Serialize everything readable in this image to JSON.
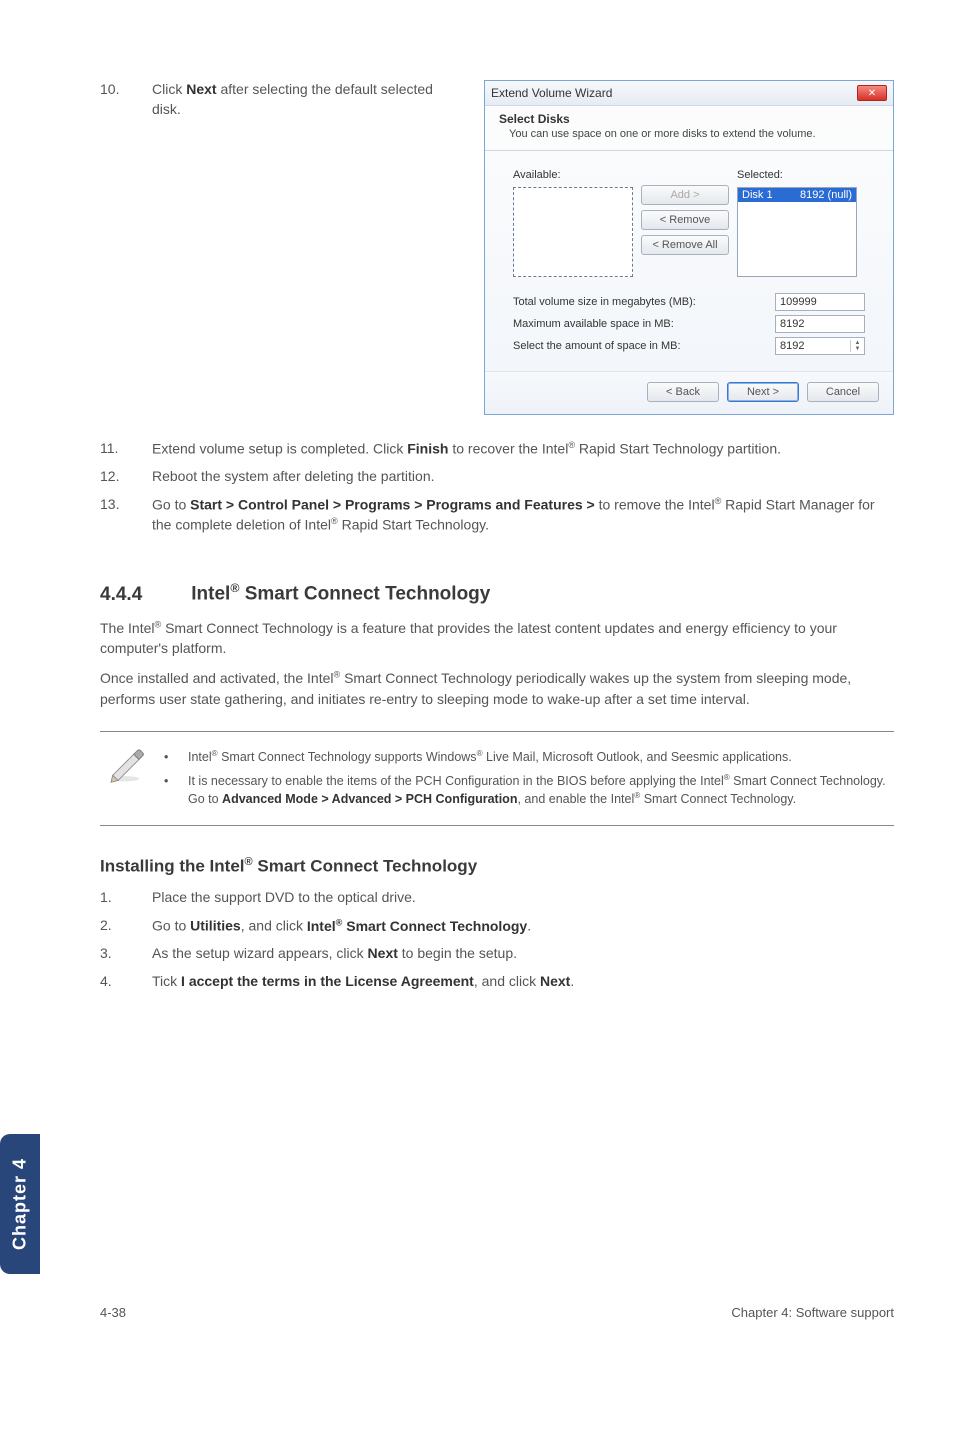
{
  "step10": {
    "num": "10.",
    "text_pre": "Click ",
    "bold": "Next",
    "text_post": " after selecting the default selected disk."
  },
  "wizard": {
    "title": "Extend Volume Wizard",
    "close_glyph": "✕",
    "heading": "Select Disks",
    "subheading": "You can use space on one or more disks to extend the volume.",
    "available_label": "Available:",
    "selected_label": "Selected:",
    "selected_item_left": "Disk 1",
    "selected_item_right": "8192 (null)",
    "btn_add": "Add >",
    "btn_remove": "< Remove",
    "btn_remove_all": "< Remove All",
    "row_total_label": "Total volume size in megabytes (MB):",
    "row_total_value": "109999",
    "row_max_label": "Maximum available space in MB:",
    "row_max_value": "8192",
    "row_sel_label": "Select the amount of space in MB:",
    "row_sel_value": "8192",
    "btn_back": "< Back",
    "btn_next": "Next >",
    "btn_cancel": "Cancel"
  },
  "step11": {
    "num": "11.",
    "pre": "Extend volume setup is completed. Click ",
    "bold": "Finish",
    "mid": " to recover the Intel",
    "post": " Rapid Start Technology partition."
  },
  "step12": {
    "num": "12.",
    "text": "Reboot the system after deleting the partition."
  },
  "step13": {
    "num": "13.",
    "pre": "Go to ",
    "bold": "Start > Control Panel > Programs > Programs and Features >",
    "mid1": " to remove the Intel",
    "mid2": " Rapid Start Manager for the complete deletion of Intel",
    "post": " Rapid Start Technology."
  },
  "section": {
    "num": "4.4.4",
    "title_pre": "Intel",
    "title_post": " Smart Connect Technology"
  },
  "para1": {
    "pre": "The Intel",
    "post": " Smart Connect Technology is a feature that provides the latest content updates and  energy efficiency to your computer's platform."
  },
  "para2": {
    "pre": "Once installed and activated, the Intel",
    "post": " Smart Connect Technology periodically wakes up the system from sleeping mode, performs user state gathering, and initiates re-entry to sleeping mode to wake-up after a set time interval."
  },
  "notes": {
    "n1": {
      "pre": "Intel",
      "mid": " Smart Connect Technology supports Windows",
      "post": " Live Mail, Microsoft Outlook, and Seesmic applications."
    },
    "n2": {
      "pre": "It is necessary to enable the items of the PCH Configuration in the BIOS before applying the Intel",
      "mid1": " Smart Connect Technology. Go to ",
      "bold": "Advanced Mode > Advanced > PCH Configuration",
      "mid2": ", and enable the Intel",
      "post": " Smart Connect Technology."
    }
  },
  "subhead": {
    "pre": "Installing the Intel",
    "post": " Smart Connect Technology"
  },
  "install": {
    "s1": {
      "num": "1.",
      "text": "Place the support DVD to the optical drive."
    },
    "s2": {
      "num": "2.",
      "pre": "Go to ",
      "b1": "Utilities",
      "mid": ", and click ",
      "b2_pre": "Intel",
      "b2_post": " Smart Connect Technology",
      "post": "."
    },
    "s3": {
      "num": "3.",
      "pre": "As the setup wizard appears, click ",
      "bold": "Next",
      "post": " to begin the setup."
    },
    "s4": {
      "num": "4.",
      "pre": "Tick ",
      "bold": "I accept the terms in the License Agreement",
      "mid": ", and click ",
      "bold2": "Next",
      "post": "."
    }
  },
  "sidetab": "Chapter 4",
  "footer": {
    "left": "4-38",
    "right": "Chapter 4: Software support"
  },
  "reg": "®"
}
